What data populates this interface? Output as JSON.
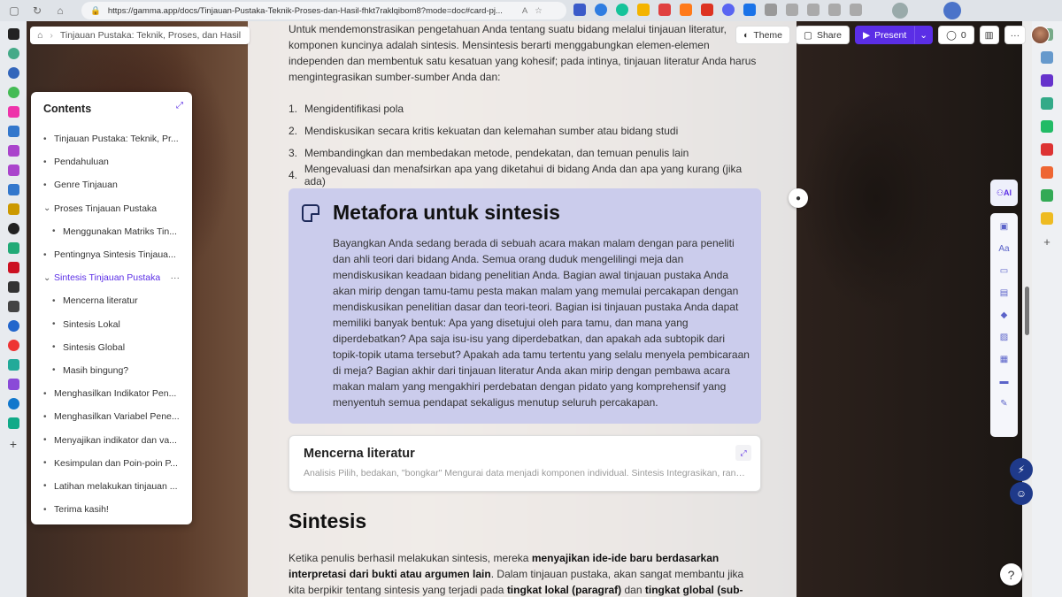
{
  "browser": {
    "url": "https://gamma.app/docs/Tinjauan-Pustaka-Teknik-Proses-dan-Hasil-fhkt7raklqibom8?mode=doc#card-pj..."
  },
  "breadcrumb": {
    "home_icon": "home-icon",
    "current": "Tinjauan Pustaka: Teknik, Proses, dan Hasil"
  },
  "toolbar": {
    "theme_label": "Theme",
    "share_label": "Share",
    "present_label": "Present",
    "comments_count": "0"
  },
  "contents": {
    "title": "Contents",
    "items": [
      {
        "label": "Tinjauan Pustaka: Teknik, Pr...",
        "bullet": "•"
      },
      {
        "label": "Pendahuluan",
        "bullet": "•"
      },
      {
        "label": "Genre Tinjauan",
        "bullet": "•"
      },
      {
        "label": "Proses Tinjauan Pustaka",
        "bullet": "⌄"
      },
      {
        "label": "Menggunakan Matriks Tin...",
        "bullet": "•"
      },
      {
        "label": "Pentingnya Sintesis Tinjaua...",
        "bullet": "•"
      },
      {
        "label": "Sintesis Tinjauan Pustaka",
        "bullet": "⌄",
        "more": "···"
      },
      {
        "label": "Mencerna literatur",
        "bullet": "•"
      },
      {
        "label": "Sintesis Lokal",
        "bullet": "•"
      },
      {
        "label": "Sintesis Global",
        "bullet": "•"
      },
      {
        "label": "Masih bingung?",
        "bullet": "•"
      },
      {
        "label": "Menghasilkan Indikator Pen...",
        "bullet": "•"
      },
      {
        "label": "Menghasilkan Variabel Pene...",
        "bullet": "•"
      },
      {
        "label": "Menyajikan indikator dan va...",
        "bullet": "•"
      },
      {
        "label": "Kesimpulan dan Poin-poin P...",
        "bullet": "•"
      },
      {
        "label": "Latihan melakukan tinjauan ...",
        "bullet": "•"
      },
      {
        "label": "Terima kasih!",
        "bullet": "•"
      }
    ]
  },
  "doc": {
    "intro": "Untuk mendemonstrasikan pengetahuan Anda tentang suatu bidang melalui tinjauan literatur, komponen kuncinya adalah sintesis. Mensintesis berarti menggabungkan elemen-elemen independen dan membentuk satu kesatuan yang kohesif; pada intinya, tinjauan literatur Anda harus mengintegrasikan sumber-sumber Anda dan:",
    "steps": [
      {
        "n": "1.",
        "text": "Mengidentifikasi pola"
      },
      {
        "n": "2.",
        "text": "Mendiskusikan secara kritis kekuatan dan kelemahan sumber atau bidang studi"
      },
      {
        "n": "3.",
        "text": "Membandingkan dan membedakan metode, pendekatan, dan temuan penulis lain"
      },
      {
        "n": "4.",
        "text": "Mengevaluasi dan menafsirkan apa yang diketahui di bidang Anda dan apa yang kurang (jika ada)"
      }
    ],
    "callout": {
      "title": "Metafora untuk sintesis",
      "body": "Bayangkan Anda sedang berada di sebuah acara makan malam dengan para peneliti dan ahli teori dari bidang Anda. Semua orang duduk mengelilingi meja dan mendiskusikan keadaan bidang penelitian Anda. Bagian awal tinjauan pustaka Anda akan mirip dengan tamu-tamu pesta makan malam yang memulai percakapan dengan mendiskusikan penelitian dasar dan teori-teori. Bagian isi tinjauan pustaka Anda dapat memiliki banyak bentuk: Apa yang disetujui oleh para tamu, dan mana yang diperdebatkan? Apa saja isu-isu yang diperdebatkan, dan apakah ada subtopik dari topik-topik utama tersebut? Apakah ada tamu tertentu yang selalu menyela pembicaraan di meja? Bagian akhir dari tinjauan literatur Anda akan mirip dengan pembawa acara makan malam yang mengakhiri perdebatan dengan pidato yang komprehensif yang menyentuh semua pendapat sekaligus menutup seluruh percakapan."
    },
    "card": {
      "title": "Mencerna literatur",
      "desc": "Analisis Pilih, bedakan, \"bongkar\" Mengurai data menjadi komponen individual. Sintesis Integrasikan, rangka..."
    },
    "sintesis": {
      "title": "Sintesis",
      "p1": "Ketika penulis berhasil melakukan sintesis, mereka ",
      "b1": "menyajikan ide-ide baru berdasarkan interpretasi dari bukti atau argumen lain",
      "p2": ". Dalam tinjauan pustaka, akan sangat membantu jika kita berpikir tentang sintesis yang terjadi pada ",
      "b2": "tingkat lokal (paragraf)",
      "p3": " dan ",
      "b3": "tingkat global (sub-bab/makalah)",
      "p4": "."
    }
  },
  "side_tools": {
    "ai_label": "AI",
    "help_label": "?"
  }
}
